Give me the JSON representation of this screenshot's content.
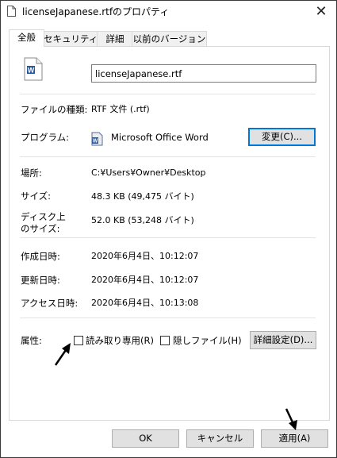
{
  "window": {
    "title": "licenseJapanese.rtfのプロパティ",
    "close_glyph": "✕"
  },
  "tabs": [
    {
      "label": "全般",
      "active": true
    },
    {
      "label": "セキュリティ",
      "active": false
    },
    {
      "label": "詳細",
      "active": false
    },
    {
      "label": "以前のバージョン",
      "active": false
    }
  ],
  "general": {
    "file_name": "licenseJapanese.rtf",
    "file_type_label": "ファイルの種類:",
    "file_type_value": "RTF 文件 (.rtf)",
    "program_label": "プログラム:",
    "program_value": "Microsoft Office Word",
    "change_button": "変更(C)...",
    "location_label": "場所:",
    "location_value": "C:¥Users¥Owner¥Desktop",
    "size_label": "サイズ:",
    "size_value": "48.3 KB (49,475 バイト)",
    "size_on_disk_label": "ディスク上\nのサイズ:",
    "size_on_disk_label_line1": "ディスク上",
    "size_on_disk_label_line2": "のサイズ:",
    "size_on_disk_value": "52.0 KB (53,248 バイト)",
    "created_label": "作成日時:",
    "created_value": "2020年6月4日、10:12:07",
    "modified_label": "更新日時:",
    "modified_value": "2020年6月4日、10:12:07",
    "accessed_label": "アクセス日時:",
    "accessed_value": "2020年6月4日、10:13:08",
    "attributes_label": "属性:",
    "readonly_label": "読み取り専用(R)",
    "readonly_checked": false,
    "hidden_label": "隠しファイル(H)",
    "hidden_checked": false,
    "advanced_button": "詳細設定(D)..."
  },
  "footer": {
    "ok_button": "OK",
    "cancel_button": "キャンセル",
    "apply_button": "適用(A)"
  },
  "colors": {
    "accent": "#0078d7",
    "arrow": "#000000"
  },
  "icons": {
    "file": "word-document-icon",
    "program": "word-app-icon",
    "arrow": "pointer-arrow-icon"
  }
}
